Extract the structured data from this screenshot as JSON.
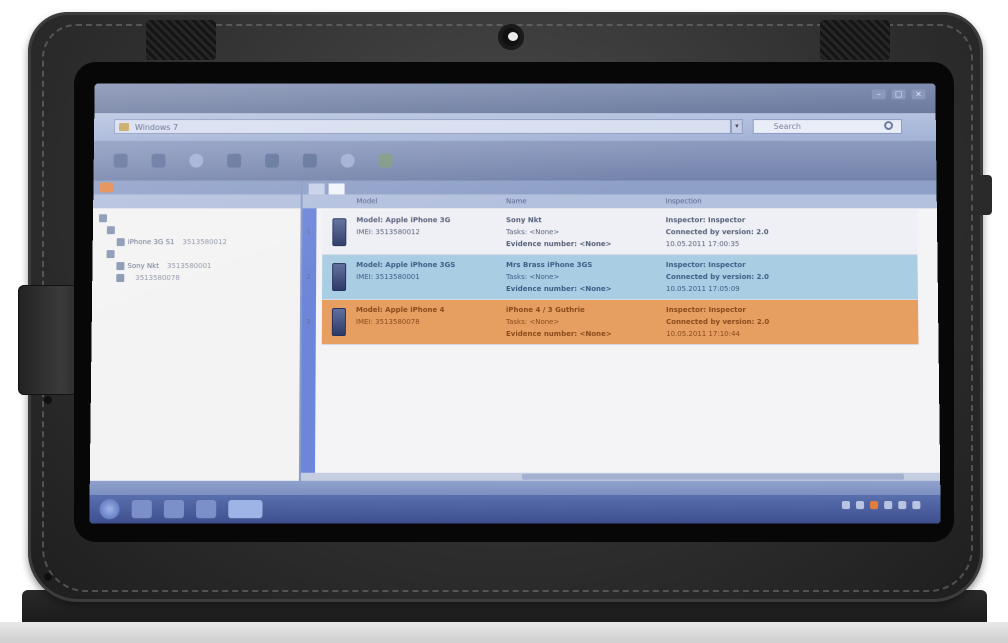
{
  "window": {
    "title": "",
    "controls": [
      "–",
      "□",
      "×"
    ]
  },
  "address": {
    "path": "Windows 7",
    "search_placeholder": "Search"
  },
  "toolbar": {
    "items": [
      "",
      "",
      "",
      "",
      "",
      "",
      "",
      ""
    ]
  },
  "left_panel": {
    "header": "",
    "columns": [
      "",
      ""
    ],
    "tree": [
      {
        "label": "",
        "value": ""
      },
      {
        "label": "",
        "value": ""
      },
      {
        "label": "iPhone 3G S1",
        "value": "3513580012"
      },
      {
        "label": "",
        "value": ""
      },
      {
        "label": "Sony Nkt",
        "value": "3513580001"
      },
      {
        "label": "",
        "value": "3513580078"
      }
    ]
  },
  "right_panel": {
    "tabs": [
      "",
      ""
    ],
    "tabs_right": "",
    "columns": [
      "Model",
      "Name",
      "Inspection"
    ],
    "records": [
      {
        "num": "1",
        "model": "Model: Apple iPhone 3G",
        "imei": "IMEI: 3513580012",
        "name": "Sony Nkt",
        "lines_mid": [
          "Tasks: <None>",
          "Evidence number: <None>"
        ],
        "lines_right": [
          "Inspector: Inspector",
          "Connected by version: 2.0",
          "10.05.2011 17:00:35"
        ]
      },
      {
        "num": "2",
        "model": "Model: Apple iPhone 3GS",
        "imei": "IMEI: 3513580001",
        "name": "Mrs Brass iPhone 3GS",
        "lines_mid": [
          "Tasks: <None>",
          "Evidence number: <None>"
        ],
        "lines_right": [
          "Inspector: Inspector",
          "Connected by version: 2.0",
          "10.05.2011 17:05:09"
        ]
      },
      {
        "num": "3",
        "model": "Model: Apple iPhone 4",
        "imei": "IMEI: 3513580078",
        "name": "iPhone 4 / 3 Guthrie",
        "lines_mid": [
          "Tasks: <None>",
          "Evidence number: <None>"
        ],
        "lines_right": [
          "Inspector: Inspector",
          "Connected by version: 2.0",
          "10.05.2011 17:10:44"
        ]
      }
    ]
  },
  "status": {
    "items": [
      "",
      "",
      ""
    ]
  },
  "taskbar": {
    "clock_time": "",
    "clock_date": ""
  },
  "colors": {
    "row_highlight_blue": "#a9cde3",
    "row_highlight_orange": "#e69e61",
    "accent_blue": "#6d86d9"
  }
}
